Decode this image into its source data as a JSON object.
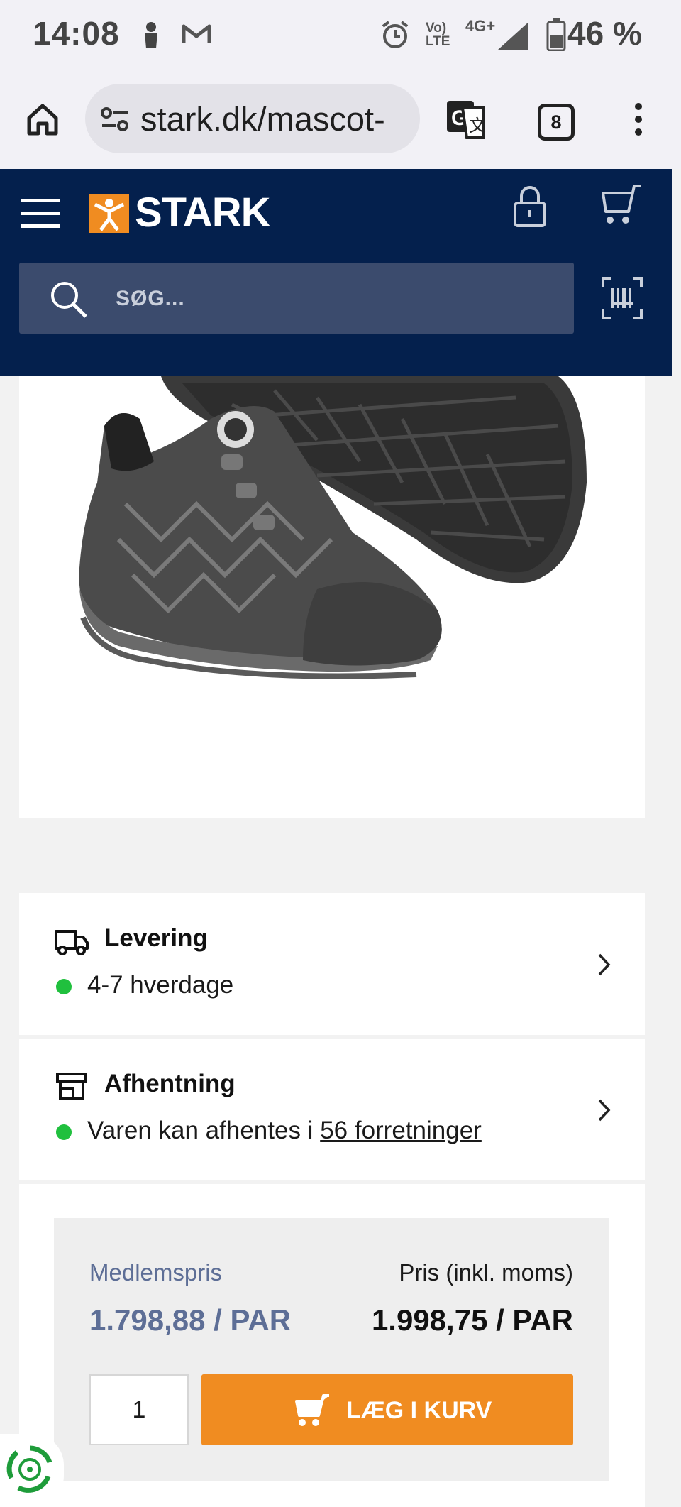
{
  "status_bar": {
    "time": "14:08",
    "network_label_1": "Vo)",
    "network_label_2": "LTE",
    "network_type": "4G+",
    "battery": "46 %"
  },
  "browser": {
    "url": "stark.dk/mascot-",
    "tab_count": "8"
  },
  "header": {
    "logo_text": "STARK",
    "search_placeholder": "SØG..."
  },
  "delivery": {
    "title": "Levering",
    "status": "4-7 hverdage"
  },
  "pickup": {
    "title": "Afhentning",
    "status_prefix": "Varen kan afhentes i ",
    "status_link": "56 forretninger"
  },
  "price": {
    "member_label": "Medlemspris",
    "member_value": "1.798,88 / PAR",
    "price_label": "Pris (inkl. moms)",
    "price_value": "1.998,75 / PAR",
    "quantity": "1",
    "add_to_cart_label": "LÆG I KURV"
  },
  "colors": {
    "navy": "#04204d",
    "orange": "#f08c21",
    "member_blue": "#5d6e96",
    "status_green": "#20c03e"
  },
  "icons": [
    "home-icon",
    "site-info-icon",
    "translate-icon",
    "tabs-icon",
    "more-icon",
    "menu-icon",
    "lock-icon",
    "cart-icon",
    "search-icon",
    "barcode-icon",
    "truck-icon",
    "store-icon",
    "chevron-right-icon",
    "recycle-icon"
  ]
}
